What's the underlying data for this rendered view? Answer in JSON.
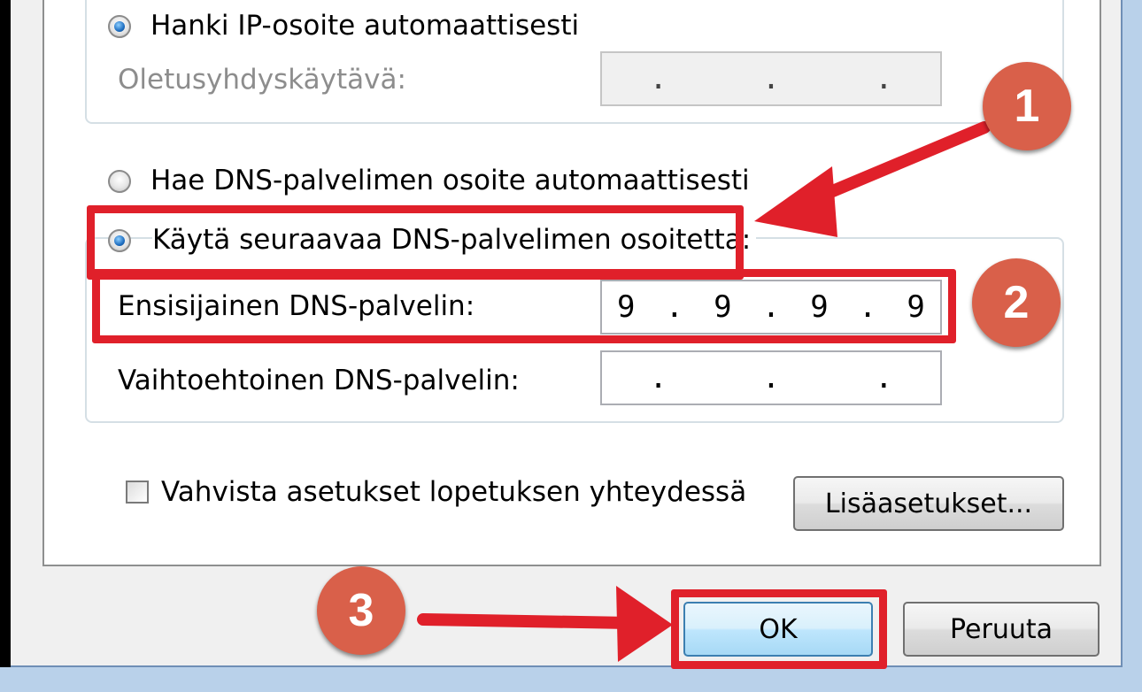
{
  "ip_section": {
    "auto_ip_label": "Hanki IP-osoite automaattisesti",
    "gateway_label": "Oletusyhdyskäytävä:",
    "gateway_value": [
      ".",
      ".",
      "."
    ]
  },
  "dns_section": {
    "auto_dns_label": "Hae DNS-palvelimen osoite automaattisesti",
    "manual_dns_label": "Käytä seuraavaa DNS-palvelimen osoitetta:",
    "preferred_label": "Ensisijainen DNS-palvelin:",
    "preferred_value": [
      "9",
      ".",
      "9",
      ".",
      "9",
      ".",
      "9"
    ],
    "alternate_label": "Vaihtoehtoinen DNS-palvelin:",
    "alternate_value": [
      ".",
      ".",
      "."
    ]
  },
  "options": {
    "validate_label": "Vahvista asetukset lopetuksen yhteydessä",
    "advanced_button": "Lisäasetukset..."
  },
  "dialog_buttons": {
    "ok": "OK",
    "cancel": "Peruuta"
  },
  "annotations": {
    "step1": "1",
    "step2": "2",
    "step3": "3",
    "highlight_color": "#e0202a",
    "marker_color": "#d9604a"
  },
  "state": {
    "auto_ip_selected": true,
    "auto_dns_selected": false,
    "manual_dns_selected": true,
    "validate_checked": false
  }
}
